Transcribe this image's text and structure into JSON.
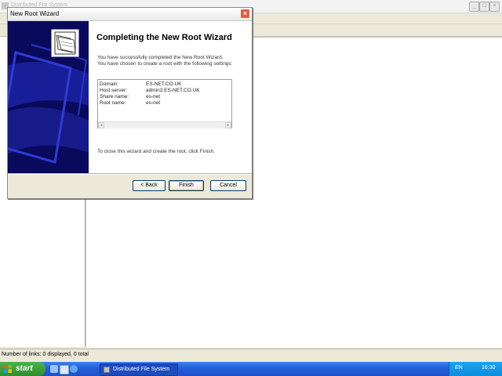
{
  "background_window": {
    "title": "Distributed File System",
    "status": "Number of links: 0 displayed, 0 total"
  },
  "dialog": {
    "title": "New Root Wizard",
    "heading": "Completing the New Root Wizard",
    "intro_line1": "You have successfully completed the New Root Wizard.",
    "intro_line2": "You have chosen to create a root with the following settings:",
    "settings": [
      {
        "key": "Domain:",
        "value": "ES-NET.CO.UK"
      },
      {
        "key": "Host server:",
        "value": "admin3.ES-NET.CO.UK"
      },
      {
        "key": "Share name:",
        "value": "es-net"
      },
      {
        "key": "Root name:",
        "value": "es-net"
      }
    ],
    "close_note": "To close this wizard and create the root, click Finish.",
    "buttons": {
      "back": "< Back",
      "finish": "Finish",
      "cancel": "Cancel"
    }
  },
  "taskbar": {
    "start_label": "start",
    "active_task": "Distributed File System",
    "language": "EN",
    "clock": "16:30"
  },
  "colors": {
    "banner": "#0a0a5c",
    "taskbar": "#245edb",
    "start_button": "#2f8e2f"
  }
}
